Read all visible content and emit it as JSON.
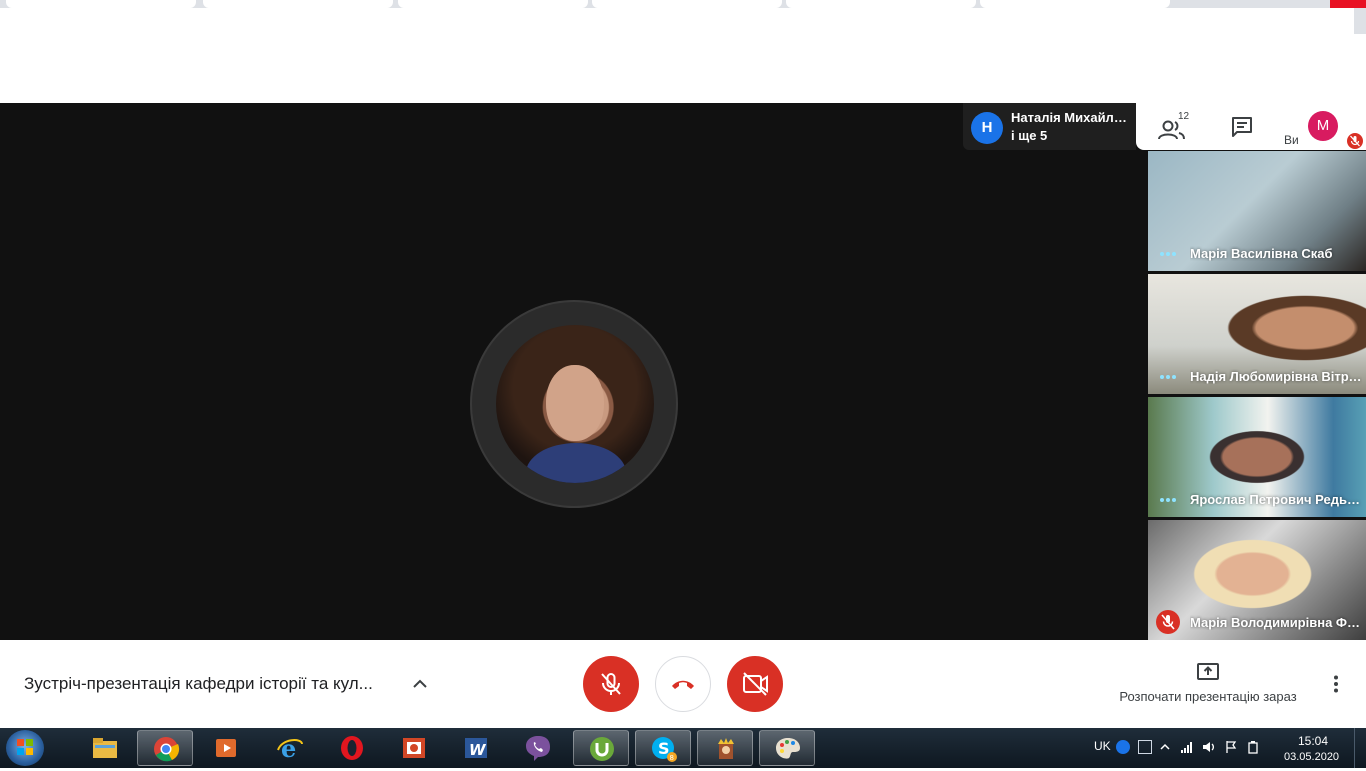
{
  "presenter": {
    "initial": "Н",
    "name": "Наталія Михайлівна",
    "more": "і ще 5"
  },
  "top_actions": {
    "people_count": "12",
    "you_label": "Ви",
    "you_initial": "M"
  },
  "tiles": [
    {
      "name": "Марія Василівна Скаб",
      "muted": false
    },
    {
      "name": "Надія Любомирівна Вітрук",
      "muted": false
    },
    {
      "name": "Ярослав Петрович Редькін",
      "muted": false
    },
    {
      "name": "Марія Володимирівна Фідик",
      "muted": true
    }
  ],
  "controls": {
    "meeting_title": "Зустріч-презентація кафедри історії та кул...",
    "present_label": "Розпочати презентацію зараз"
  },
  "taskbar": {
    "apps": [
      "file-explorer",
      "chrome",
      "media-player",
      "internet-explorer",
      "opera",
      "powerpoint",
      "word",
      "viber",
      "utorrent",
      "skype",
      "game",
      "paint"
    ],
    "language": "UK",
    "time": "15:04",
    "date": "03.05.2020",
    "skype_badge": "8"
  },
  "colors": {
    "stage_bg": "#111111",
    "danger_red": "#d93025",
    "presenter_blue": "#1a73e8",
    "you_pink": "#d81b60"
  }
}
